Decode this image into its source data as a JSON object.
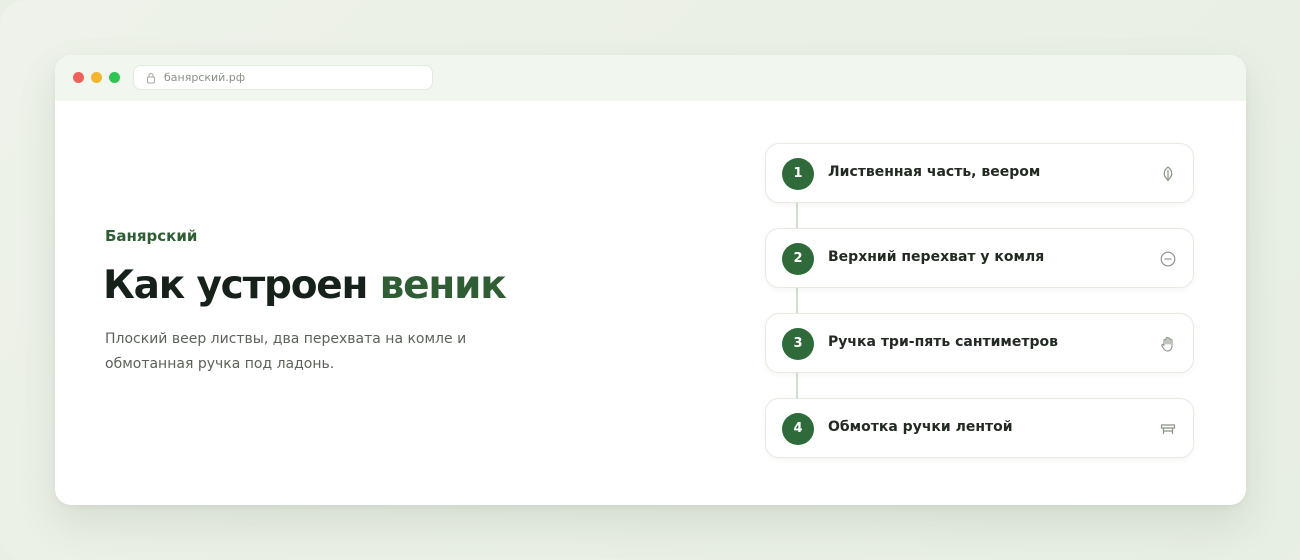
{
  "browser": {
    "url": "банярский.рф",
    "icons": {
      "lock": "lock-icon"
    },
    "window_controls": [
      "close",
      "minimize",
      "maximize"
    ]
  },
  "hero": {
    "brand": "Банярский",
    "title_main": "Как устроен ",
    "title_accent": "веник",
    "description": "Плоский веер листвы, два перехвата на комле и обмотанная ручка под ладонь."
  },
  "steps": [
    {
      "number": "1",
      "label": "Лиственная часть, веером",
      "icon": "leaf-icon"
    },
    {
      "number": "2",
      "label": "Верхний перехват у комля",
      "icon": "minus-circle-icon"
    },
    {
      "number": "3",
      "label": "Ручка три-пять сантиметров",
      "icon": "hand-icon"
    },
    {
      "number": "4",
      "label": "Обмотка ручки лентой",
      "icon": "bench-icon"
    }
  ],
  "colors": {
    "accent": "#2f5e34",
    "step_badge": "#2f6b3a",
    "page_background": "#e9efe5",
    "chrome_background": "#f1f6ef"
  }
}
